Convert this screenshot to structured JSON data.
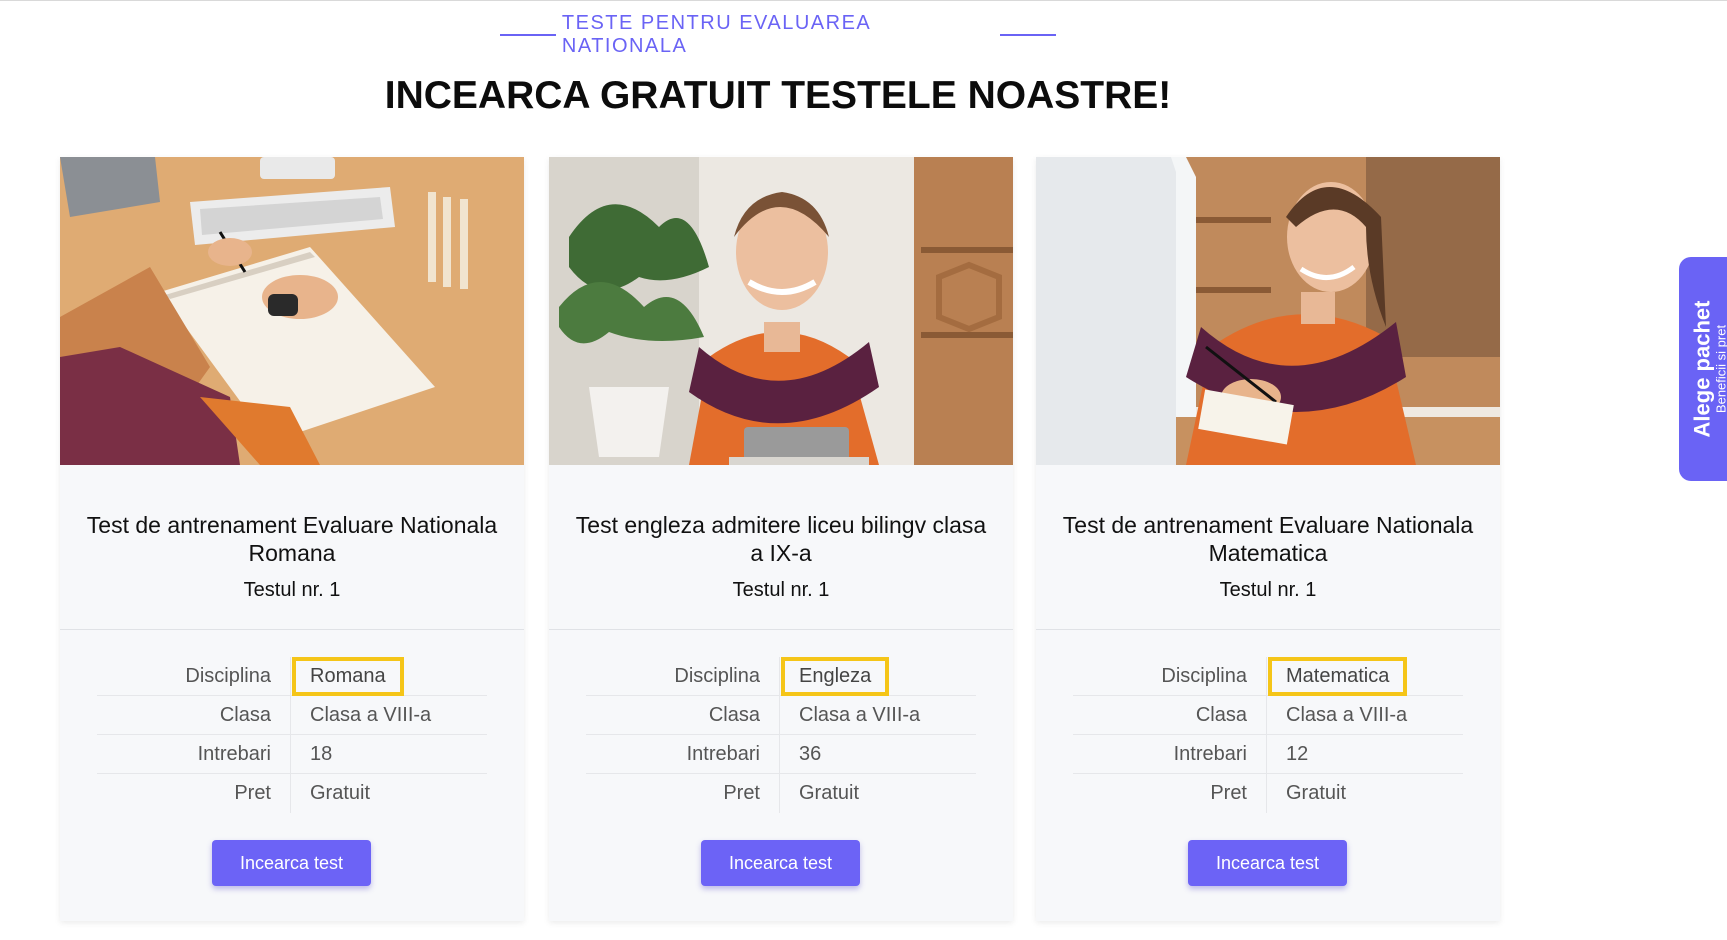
{
  "section": {
    "eyebrow": "TESTE PENTRU EVALUAREA NATIONALA",
    "headline": "INCEARCA GRATUIT TESTELE NOASTRE!"
  },
  "cards": [
    {
      "title": "Test de antrenament Evaluare Nationala Romana",
      "subtitle": "Testul nr. 1",
      "specs": [
        {
          "key": "Disciplina",
          "value": "Romana"
        },
        {
          "key": "Clasa",
          "value": "Clasa a VIII-a"
        },
        {
          "key": "Intrebari",
          "value": "18"
        },
        {
          "key": "Pret",
          "value": "Gratuit"
        }
      ],
      "button": "Incearca test"
    },
    {
      "title": "Test engleza admitere liceu bilingv clasa a IX-a",
      "subtitle": "Testul nr. 1",
      "specs": [
        {
          "key": "Disciplina",
          "value": "Engleza"
        },
        {
          "key": "Clasa",
          "value": "Clasa a VIII-a"
        },
        {
          "key": "Intrebari",
          "value": "36"
        },
        {
          "key": "Pret",
          "value": "Gratuit"
        }
      ],
      "button": "Incearca test"
    },
    {
      "title": "Test de antrenament Evaluare Nationala Matematica",
      "subtitle": "Testul nr. 1",
      "specs": [
        {
          "key": "Disciplina",
          "value": "Matematica"
        },
        {
          "key": "Clasa",
          "value": "Clasa a VIII-a"
        },
        {
          "key": "Intrebari",
          "value": "12"
        },
        {
          "key": "Pret",
          "value": "Gratuit"
        }
      ],
      "button": "Incearca test"
    }
  ],
  "side_tab": {
    "title": "Alege pachet",
    "subtitle": "Beneficii si pret"
  },
  "colors": {
    "accent": "#6a63f5",
    "button": "#6c63f6",
    "highlight": "#f5c518",
    "card_bg": "#f7f8fa"
  }
}
